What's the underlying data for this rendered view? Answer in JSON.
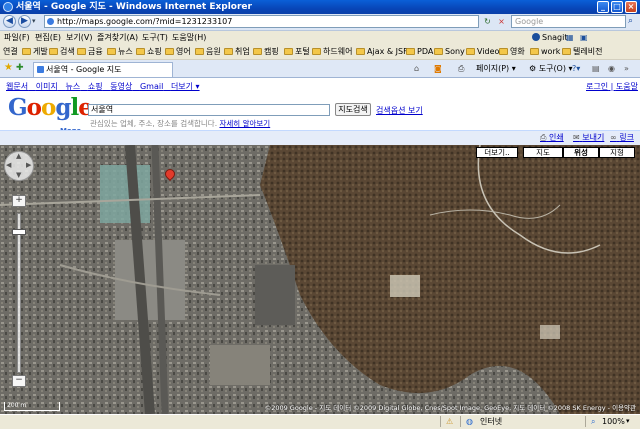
{
  "window": {
    "title": "서울역 - Google 지도 - Windows Internet Explorer",
    "min": "_",
    "max": "□",
    "close": "×"
  },
  "nav": {
    "back": "◀",
    "forward": "▶",
    "url": "http://maps.google.com/?mid=1231233107",
    "refresh": "↻",
    "stop": "×",
    "search_placeholder": "Google"
  },
  "menu": {
    "items": [
      "파일(F)",
      "편집(E)",
      "보기(V)",
      "즐겨찾기(A)",
      "도구(T)",
      "도움말(H)"
    ],
    "snagit": "Snagit"
  },
  "favorites": {
    "label": "연결",
    "items": [
      "게발",
      "검색",
      "금융",
      "뉴스",
      "쇼핑",
      "영어",
      "음원",
      "취업",
      "캠핑",
      "포털",
      "하드웨어",
      "Ajax & JSF",
      "PDA",
      "Sony",
      "Video",
      "영화",
      "work",
      "텔레비전"
    ]
  },
  "tabs": {
    "active": "서울역 - Google 지도",
    "toolbar_page": "페이지(P)",
    "toolbar_tools": "도구(O)"
  },
  "google": {
    "links_left": [
      "웹문서",
      "이미지",
      "뉴스",
      "쇼핑",
      "동영상",
      "Gmail",
      "더보기 ▾"
    ],
    "links_right": [
      "로그인",
      "도움말"
    ],
    "logo": "Google",
    "maps_label": "Maps",
    "query": "서울역",
    "search_button": "지도검색",
    "search_options": "검색옵션 보기",
    "hint": "관심있는 업체, 주소, 장소를 검색합니다.",
    "hint_link": "자세히 알아보기",
    "actions": [
      "인쇄",
      "보내기",
      "링크"
    ]
  },
  "map": {
    "types": [
      "더보기..",
      "지도",
      "위성",
      "지형"
    ],
    "active_type": "위성",
    "zoom_in": "+",
    "zoom_out": "−",
    "scale_text": "200 m",
    "copyright": "©2009 Google - 지도 데이터 ©2009 Digital Globe, Cnes/Spot Image, GeoEye, 지도 데이터 ©2008 SK Energy - 이용약관"
  },
  "status": {
    "zone": "인터넷",
    "zoom": "100%"
  },
  "colors": {
    "titlebar": "#0a5fd8",
    "link": "#0000cc",
    "google_blue": "#3366cc",
    "google_red": "#dd2200",
    "google_yellow": "#eeaa00",
    "google_green": "#119922"
  }
}
